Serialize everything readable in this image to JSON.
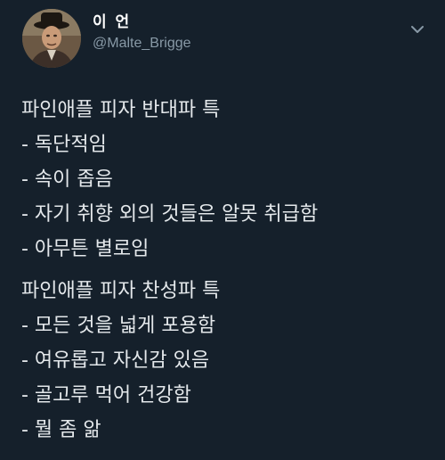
{
  "author": {
    "display_name": "이 언",
    "handle": "@Malte_Brigge"
  },
  "icons": {
    "avatar": "portrait-avatar",
    "menu": "chevron-down-icon"
  },
  "colors": {
    "background": "#15202b",
    "text": "#e4e8eb",
    "secondary": "#8899a6"
  },
  "tweet": {
    "section_1": [
      "파인애플 피자 반대파 특",
      "- 독단적임",
      "- 속이 좁음",
      "- 자기 취향 외의 것들은 알못 취급함",
      "- 아무튼 별로임"
    ],
    "section_2": [
      "파인애플 피자 찬성파 특",
      "- 모든 것을 넓게 포용함",
      "- 여유롭고 자신감 있음",
      "- 골고루 먹어 건강함",
      "- 뭘 좀 앎"
    ]
  }
}
